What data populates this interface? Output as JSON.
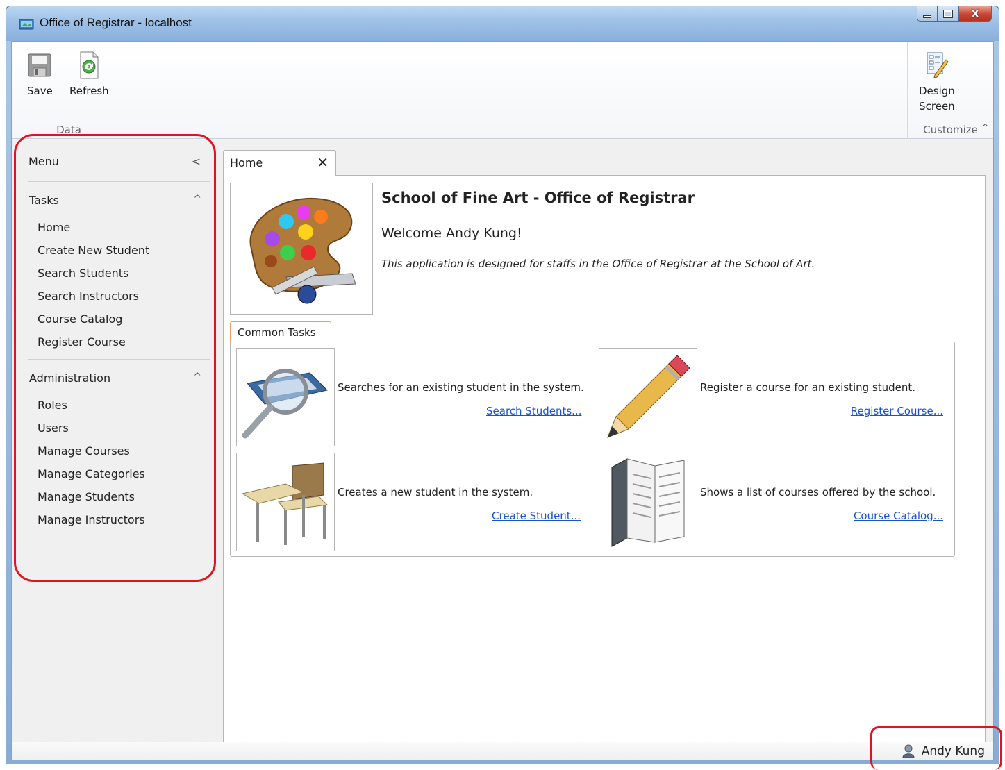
{
  "window": {
    "title": "Office of Registrar - localhost",
    "controls": {
      "minimize": "",
      "maximize": "",
      "close": "X"
    }
  },
  "ribbon": {
    "data_group": {
      "label": "Data",
      "save_label": "Save",
      "refresh_label": "Refresh"
    },
    "customize_group": {
      "label": "Customize",
      "design_line1": "Design",
      "design_line2": "Screen",
      "collapse_glyph": "^"
    }
  },
  "sidebar": {
    "menu_label": "Menu",
    "menu_caret": "<",
    "sections": [
      {
        "label": "Tasks",
        "caret": "^",
        "items": [
          "Home",
          "Create New Student",
          "Search Students",
          "Search Instructors",
          "Course Catalog",
          "Register Course"
        ]
      },
      {
        "label": "Administration",
        "caret": "^",
        "items": [
          "Roles",
          "Users",
          "Manage Courses",
          "Manage Categories",
          "Manage Students",
          "Manage Instructors"
        ]
      }
    ]
  },
  "tabs": [
    {
      "label": "Home",
      "close_glyph": "✕"
    }
  ],
  "home": {
    "title": "School of Fine Art - Office of Registrar",
    "welcome": "Welcome Andy Kung!",
    "description": "This application is designed for staffs in the Office of Registrar at the School of Art.",
    "common_tasks_label": "Common Tasks",
    "tasks": [
      {
        "description": "Searches for an existing student in the system.",
        "link": "Search Students..."
      },
      {
        "description": "Register a course for an existing student.",
        "link": "Register Course..."
      },
      {
        "description": "Creates a new student in the system.",
        "link": "Create Student..."
      },
      {
        "description": "Shows a list of courses offered by the school.",
        "link": "Course Catalog..."
      }
    ]
  },
  "status_bar": {
    "user_name": "Andy Kung"
  },
  "colors": {
    "accent_link": "#1a55c8",
    "highlight": "#e0141e",
    "title_bar": "#9ec0e6"
  },
  "icons": [
    "app-icon",
    "save-icon",
    "refresh-icon",
    "design-screen-icon",
    "palette-icon",
    "search-magnifier-icon",
    "pencil-icon",
    "desk-icon",
    "book-icon",
    "user-icon"
  ]
}
